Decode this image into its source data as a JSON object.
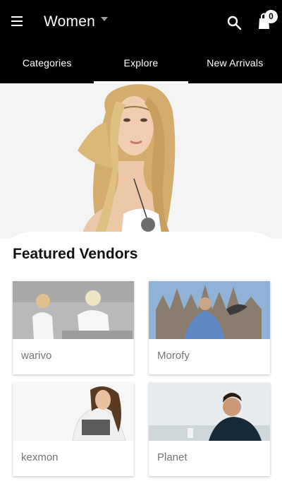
{
  "header": {
    "title": "Women",
    "cart_count": "0"
  },
  "tabs": [
    {
      "label": "Categories"
    },
    {
      "label": "Explore"
    },
    {
      "label": "New Arrivals"
    }
  ],
  "featured": {
    "title": "Featured Vendors",
    "vendors": [
      {
        "name": "warivo"
      },
      {
        "name": "Morofy"
      },
      {
        "name": "kexmon"
      },
      {
        "name": "Planet"
      }
    ]
  }
}
